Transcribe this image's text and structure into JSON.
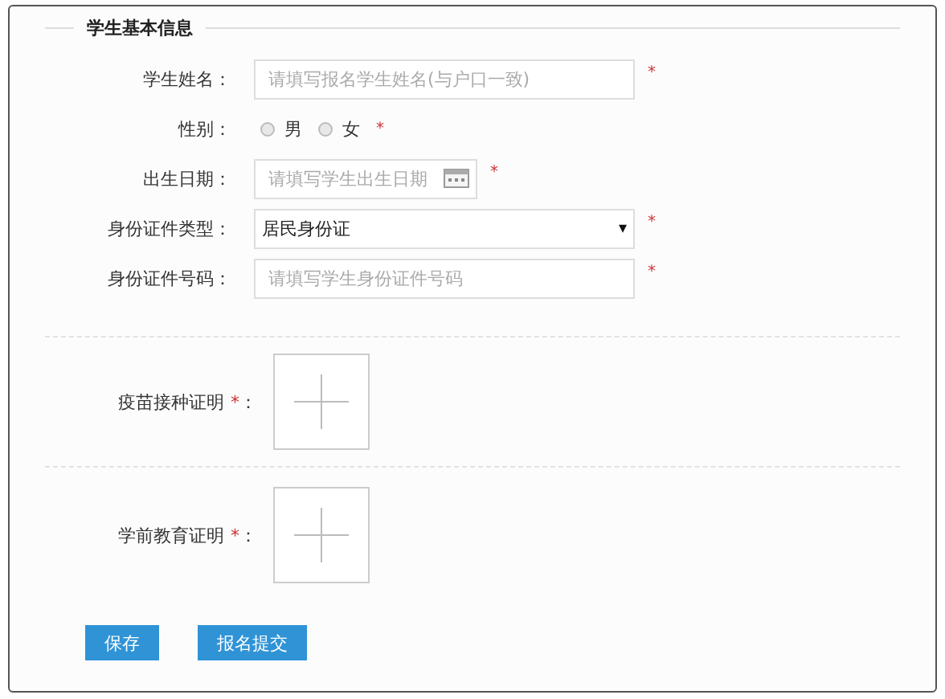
{
  "section": {
    "title": "学生基本信息"
  },
  "fields": [
    {
      "kind": "text",
      "label": "学生姓名：",
      "placeholder": "请填写报名学生姓名(与户口一致)",
      "required_mark": "*"
    },
    {
      "kind": "radio",
      "label": "性别：",
      "options": [
        {
          "label": "男",
          "selected": false
        },
        {
          "label": "女",
          "selected": false
        }
      ],
      "required_mark": "*"
    },
    {
      "kind": "date",
      "label": "出生日期：",
      "placeholder": "请填写学生出生日期",
      "required_mark": "*"
    },
    {
      "kind": "select",
      "label": "身份证件类型：",
      "value": "居民身份证",
      "caret": "▾",
      "required_mark": "*"
    },
    {
      "kind": "text",
      "label": "身份证件号码：",
      "placeholder": "请填写学生身份证件号码",
      "required_mark": "*"
    }
  ],
  "uploads": [
    {
      "label": "疫苗接种证明",
      "required_mark": "*",
      "colon": "："
    },
    {
      "label": "学前教育证明",
      "required_mark": "*",
      "colon": "："
    }
  ],
  "buttons": [
    {
      "label": "保存"
    },
    {
      "label": "报名提交"
    }
  ]
}
